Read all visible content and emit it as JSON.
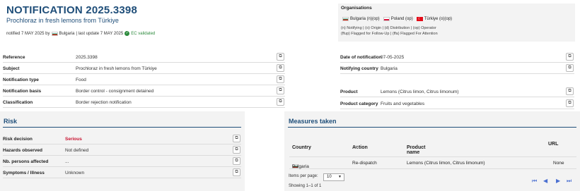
{
  "header": {
    "title": "NOTIFICATION 2025.3398",
    "subtitle": "Prochloraz in fresh lemons from Türkiye",
    "notified_prefix": "notified 7 MAY 2025 by",
    "notified_country": "Bulgaria",
    "last_update": "| last update 7 MAY 2025",
    "validated": "EC validated"
  },
  "organisations": {
    "title": "Organisations",
    "items": [
      {
        "country": "Bulgaria (n)(op)",
        "flag": "bg"
      },
      {
        "country": "Poland (op)",
        "flag": "pl"
      },
      {
        "country": "Türkiye (o)(op)",
        "flag": "tr"
      }
    ],
    "legend1": "(n) Notifying | (o) Origin | (d) Distribution | (op) Operator",
    "legend2": "(ffup) Flagged for Follow-Up | (ffa) Flagged For Attention"
  },
  "left_fields": [
    {
      "label": "Reference",
      "value": "2025.3398"
    },
    {
      "label": "Subject",
      "value": "Prochloraz in fresh lemons from Türkiye"
    },
    {
      "label": "Notification type",
      "value": "Food"
    },
    {
      "label": "Notification basis",
      "value": "Border control - consignment detained"
    },
    {
      "label": "Classification",
      "value": "Border rejection notification"
    }
  ],
  "right_fields": [
    {
      "label": "Date of notification",
      "value": "07-05-2025"
    },
    {
      "label": "Notifying country",
      "value": "Bulgaria"
    },
    {
      "label": "Product",
      "value": "Lemons (Citrus limon, Citrus limonum)"
    },
    {
      "label": "Product category",
      "value": "Fruits and vegetables"
    }
  ],
  "risk": {
    "title": "Risk",
    "fields": [
      {
        "label": "Risk decision",
        "value": "Serious"
      },
      {
        "label": "Hazards observed",
        "value": "Not defined"
      },
      {
        "label": "Nb. persons affected",
        "value": "..."
      },
      {
        "label": "Symptoms / Illness",
        "value": "Unknown"
      }
    ]
  },
  "measures": {
    "title": "Measures taken",
    "columns": [
      "Country",
      "Action",
      "Product name",
      "URL"
    ],
    "rows": [
      {
        "country": "Bulgaria",
        "action": "Re-dispatch",
        "product": "Lemons (Citrus limon, Citrus limonum)",
        "url": "None"
      }
    ],
    "items_per_page_label": "Items per page:",
    "items_per_page_value": "10",
    "showing": "Showing 1–1 of 1"
  },
  "icons": {
    "copy": "copy-icon",
    "sort": "sort-icon",
    "check": "check-circle-icon",
    "pager": [
      "first-page-icon",
      "previous-page-icon",
      "next-page-icon",
      "last-page-icon"
    ]
  },
  "colors": {
    "title": "#1f4e79",
    "serious": "#c8102e",
    "validated": "#2e8b3e",
    "pager": "#4a6fd1"
  }
}
